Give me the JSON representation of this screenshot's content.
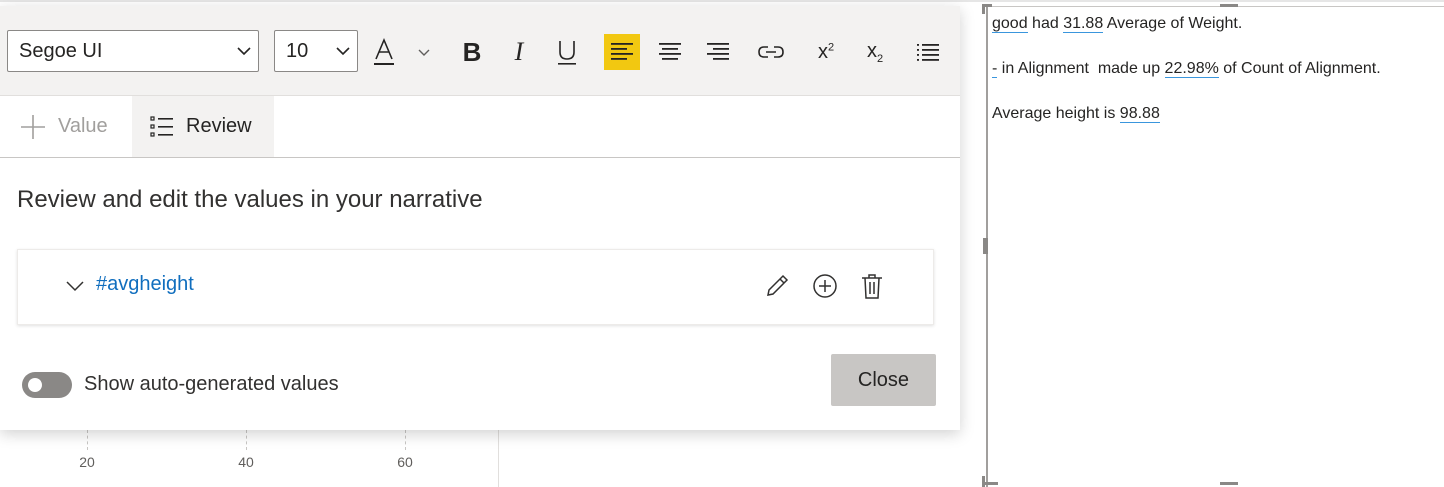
{
  "canvas": {
    "axis_ticks": [
      "20",
      "40",
      "60"
    ]
  },
  "narrative": {
    "lines": [
      {
        "parts": [
          {
            "t": "good",
            "k": "link"
          },
          {
            "t": " had ",
            "k": "text"
          },
          {
            "t": "31.88",
            "k": "num"
          },
          {
            "t": " Average of Weight.",
            "k": "text"
          }
        ]
      },
      {
        "parts": [
          {
            "t": "-",
            "k": "link"
          },
          {
            "t": " in Alignment  made up ",
            "k": "text"
          },
          {
            "t": "22.98%",
            "k": "num"
          },
          {
            "t": " of Count of Alignment.",
            "k": "text"
          }
        ]
      },
      {
        "parts": [
          {
            "t": "Average height is ",
            "k": "text"
          },
          {
            "t": "98.88",
            "k": "num"
          }
        ]
      }
    ]
  },
  "toolbar": {
    "font_family": "Segoe UI",
    "font_size": "10",
    "buttons": [
      {
        "name": "font-color-icon",
        "glyph": "A"
      },
      {
        "name": "font-color-dropdown-icon",
        "glyph": "⌄"
      },
      {
        "name": "bold-icon",
        "glyph": "B"
      },
      {
        "name": "italic-icon",
        "glyph": "I"
      },
      {
        "name": "underline-icon",
        "glyph": "U"
      },
      {
        "name": "align-left-icon",
        "glyph": "",
        "active": true
      },
      {
        "name": "align-center-icon",
        "glyph": ""
      },
      {
        "name": "align-right-icon",
        "glyph": ""
      },
      {
        "name": "link-icon",
        "glyph": ""
      },
      {
        "name": "superscript-icon",
        "glyph": "x²"
      },
      {
        "name": "subscript-icon",
        "glyph": "x₂"
      },
      {
        "name": "list-icon",
        "glyph": ""
      }
    ]
  },
  "tabs": {
    "value_label": "Value",
    "review_label": "Review"
  },
  "review": {
    "heading": "Review and edit the values in your narrative",
    "items": [
      {
        "name": "#avgheight"
      }
    ]
  },
  "footer": {
    "toggle_label": "Show auto-generated values",
    "toggle_on": false,
    "close_label": "Close"
  },
  "colors": {
    "accent_active": "#f2c811",
    "link": "#106ebe",
    "underline": "#3a96dd"
  }
}
